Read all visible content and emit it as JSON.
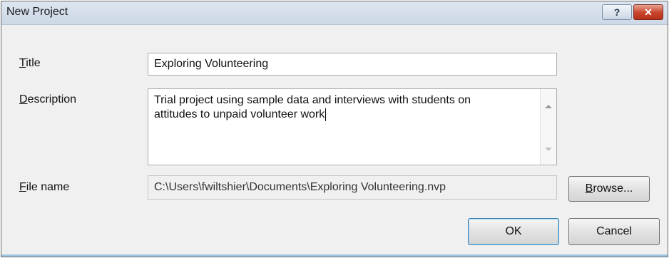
{
  "dialog": {
    "title": "New Project",
    "help_glyph": "?",
    "close_glyph": "✕"
  },
  "form": {
    "title_label_access": "T",
    "title_label_rest": "itle",
    "title_value": "Exploring Volunteering",
    "description_label_access": "D",
    "description_label_rest": "escription",
    "description_value": "Trial project using sample data and interviews with students on\nattitudes to unpaid volunteer work",
    "file_label_access": "F",
    "file_label_rest": "ile name",
    "file_value": "C:\\Users\\fwiltshier\\Documents\\Exploring Volunteering.nvp"
  },
  "buttons": {
    "browse_access": "B",
    "browse_rest": "rowse...",
    "ok": "OK",
    "cancel": "Cancel"
  }
}
